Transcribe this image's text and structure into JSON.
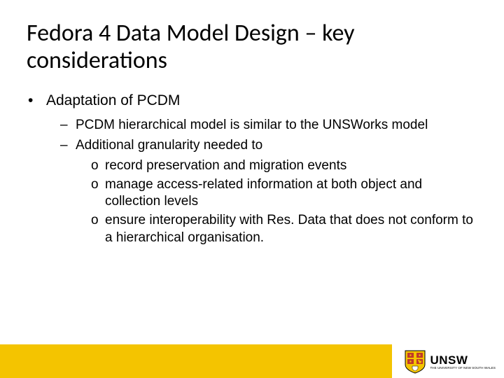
{
  "title": "Fedora 4 Data Model Design – key considerations",
  "bullets": {
    "item1": "Adaptation of PCDM",
    "sub1": "PCDM hierarchical model is similar to the UNSWorks model",
    "sub2": "Additional granularity needed to",
    "subsub1": "record preservation and migration events",
    "subsub2": "manage access-related information at both object and collection levels",
    "subsub3": "ensure interoperability with Res. Data that does not conform to a hierarchical organisation."
  },
  "logo": {
    "main": "UNSW",
    "sub": "THE UNIVERSITY OF NEW SOUTH WALES"
  },
  "markers": {
    "dot": "•",
    "dash": "–",
    "circle": "o"
  }
}
